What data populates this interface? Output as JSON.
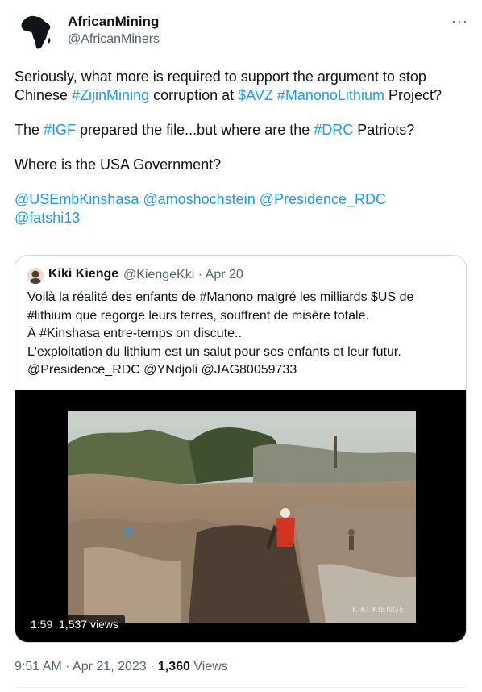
{
  "author": {
    "name": "AfricanMining",
    "handle": "@AfricanMiners",
    "avatar_icon": "africa-map-icon"
  },
  "more_icon": "more-icon",
  "tweet": {
    "p1": {
      "a": "Seriously, what more is required to support the argument to stop Chinese ",
      "zijin": "#ZijinMining",
      "b": " corruption at ",
      "avz": "$AVZ",
      "sp": " ",
      "manono": "#ManonoLithium",
      "c": " Project?"
    },
    "p2": {
      "a": "The ",
      "igf": "#IGF",
      "b": " prepared the file...but where are the ",
      "drc": "#DRC",
      "c": " Patriots?"
    },
    "p3": "Where is the USA Government?",
    "mentions": {
      "m1": "@USEmbKinshasa",
      "m2": "@amoshochstein",
      "m3": "@Presidence_RDC",
      "m4": "@fatshi13"
    }
  },
  "quote": {
    "name": "Kiki Kienge",
    "handle": "@KiengeKki",
    "date": "Apr 20",
    "lines": [
      "Voilà la réalité des enfants de #Manono malgré les milliards $US de #lithium que regorge leurs terres, souffrent de misère totale.",
      "À #Kinshasa entre-temps on discute..",
      "L'exploitation du lithium est un salut pour ses enfants et leur futur.",
      "@Presidence_RDC @YNdjoli @JAG80059733"
    ],
    "video": {
      "duration": "1:59",
      "views": "1,537 views",
      "watermark": "KIKI KIENGE"
    }
  },
  "footer": {
    "time": "9:51 AM",
    "date": "Apr 21, 2023",
    "views_count": "1,360",
    "views_label": "Views"
  },
  "colors": {
    "link": "#1d9bf0",
    "secondary_text": "#536471",
    "border": "#cfd9de"
  }
}
